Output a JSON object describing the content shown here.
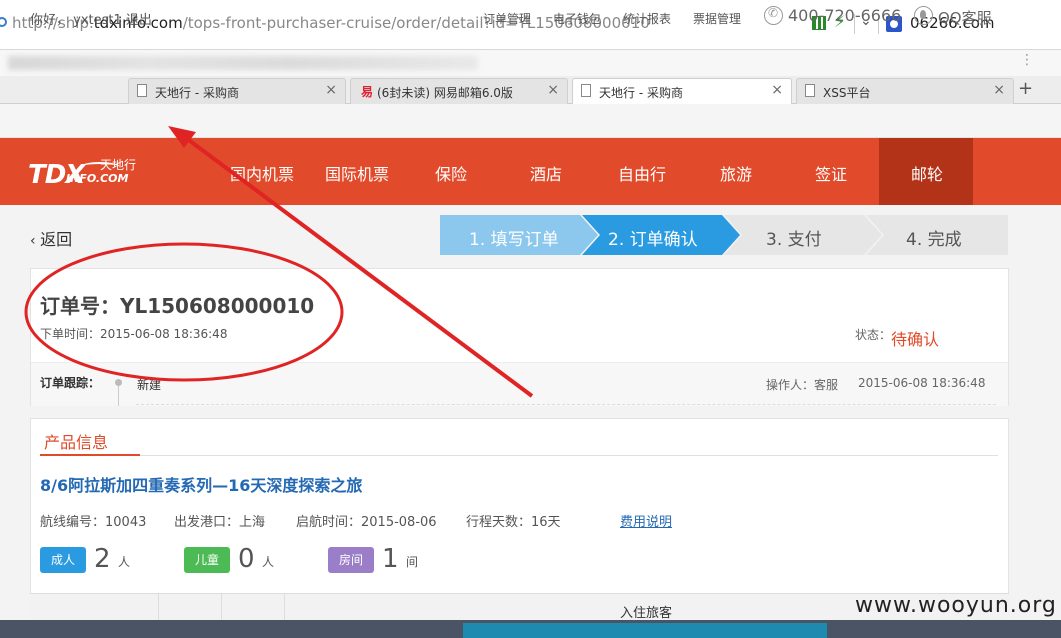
{
  "browser": {
    "url_prefix": "http://ship.",
    "url_domain": "tdxinfo.com",
    "url_path": "/tops-front-purchaser-cruise/order/detail?id=YL150608000010",
    "search_text": "06266.com",
    "tabs": [
      {
        "label": "天地行 - 采购商",
        "close": "×",
        "active": false
      },
      {
        "label": "(6封未读) 网易邮箱6.0版",
        "close": "×",
        "active": false
      },
      {
        "label": "天地行 - 采购商",
        "close": "×",
        "active": true
      },
      {
        "label": "XSS平台",
        "close": "×",
        "active": false
      }
    ],
    "new_tab": "+"
  },
  "topbar": {
    "greeting": "你好， yxtest1 退出",
    "links": [
      "订单管理",
      "电子钱包",
      "统计报表",
      "票据管理"
    ],
    "phone": "400-720-6666",
    "qq": "QQ客服"
  },
  "logo": {
    "brand": "TDX",
    "sub": "INFO.COM",
    "cn": "天地行"
  },
  "nav": {
    "items": [
      "国内机票",
      "国际机票",
      "保险",
      "酒店",
      "自由行",
      "旅游",
      "签证",
      "邮轮"
    ],
    "active_index": 7
  },
  "steps": {
    "back_label": "返回",
    "items": [
      {
        "label": "1. 填写订单",
        "color": "#8cc8ee"
      },
      {
        "label": "2. 订单确认",
        "color": "#2a9be0"
      },
      {
        "label": "3. 支付",
        "color": "#e6e6e6"
      },
      {
        "label": "4. 完成",
        "color": "#e6e6e6"
      }
    ]
  },
  "order": {
    "number_label": "订单号：YL150608000010",
    "time_label": "下单时间：2015-06-08 18:36:48",
    "status_label": "状态：",
    "status_value": "待确认",
    "tracking_label": "订单跟踪：",
    "tracking_event": "新建",
    "operator": "操作人：客服",
    "tracking_time": "2015-06-08 18:36:48"
  },
  "product": {
    "section_title": "产品信息",
    "title": "8/6阿拉斯加四重奏系列—16天深度探索之旅",
    "route_no": "航线编号：10043",
    "port": "出发港口：上海",
    "sail_time": "启航时间：2015-08-06",
    "days": "行程天数：16天",
    "fee_link": "费用说明",
    "adult_label": "成人",
    "adult_count": "2",
    "adult_unit": "人",
    "child_label": "儿童",
    "child_count": "0",
    "child_unit": "人",
    "room_label": "房间",
    "room_count": "1",
    "room_unit": "间",
    "table_title": "入住旅客"
  },
  "colors": {
    "brand_red": "#e14a2a",
    "link_blue": "#2469b3",
    "adult": "#2a9be0",
    "child": "#4cbb55",
    "room": "#9a7fc8"
  },
  "watermark": "www.wooyun.org"
}
